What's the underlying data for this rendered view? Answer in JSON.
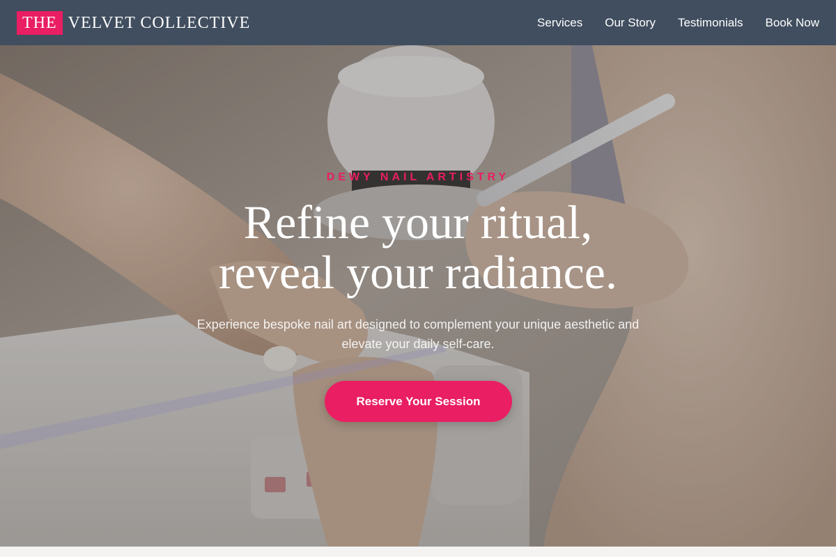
{
  "header": {
    "brand_box": "THE",
    "brand_rest": "VELVET COLLECTIVE",
    "nav": [
      {
        "label": "Services"
      },
      {
        "label": "Our Story"
      },
      {
        "label": "Testimonials"
      },
      {
        "label": "Book Now"
      }
    ]
  },
  "hero": {
    "eyebrow": "DEWY NAIL ARTISTRY",
    "headline_line1": "Refine your ritual,",
    "headline_line2": "reveal your radiance.",
    "subtext": "Experience bespoke nail art designed to complement your unique aesthetic and elevate your daily self-care.",
    "cta_label": "Reserve Your Session",
    "image_subject": "manicure-in-progress-photo"
  },
  "colors": {
    "accent": "#e91e63",
    "header_bg": "#404e5f",
    "hero_text": "#ffffff"
  }
}
